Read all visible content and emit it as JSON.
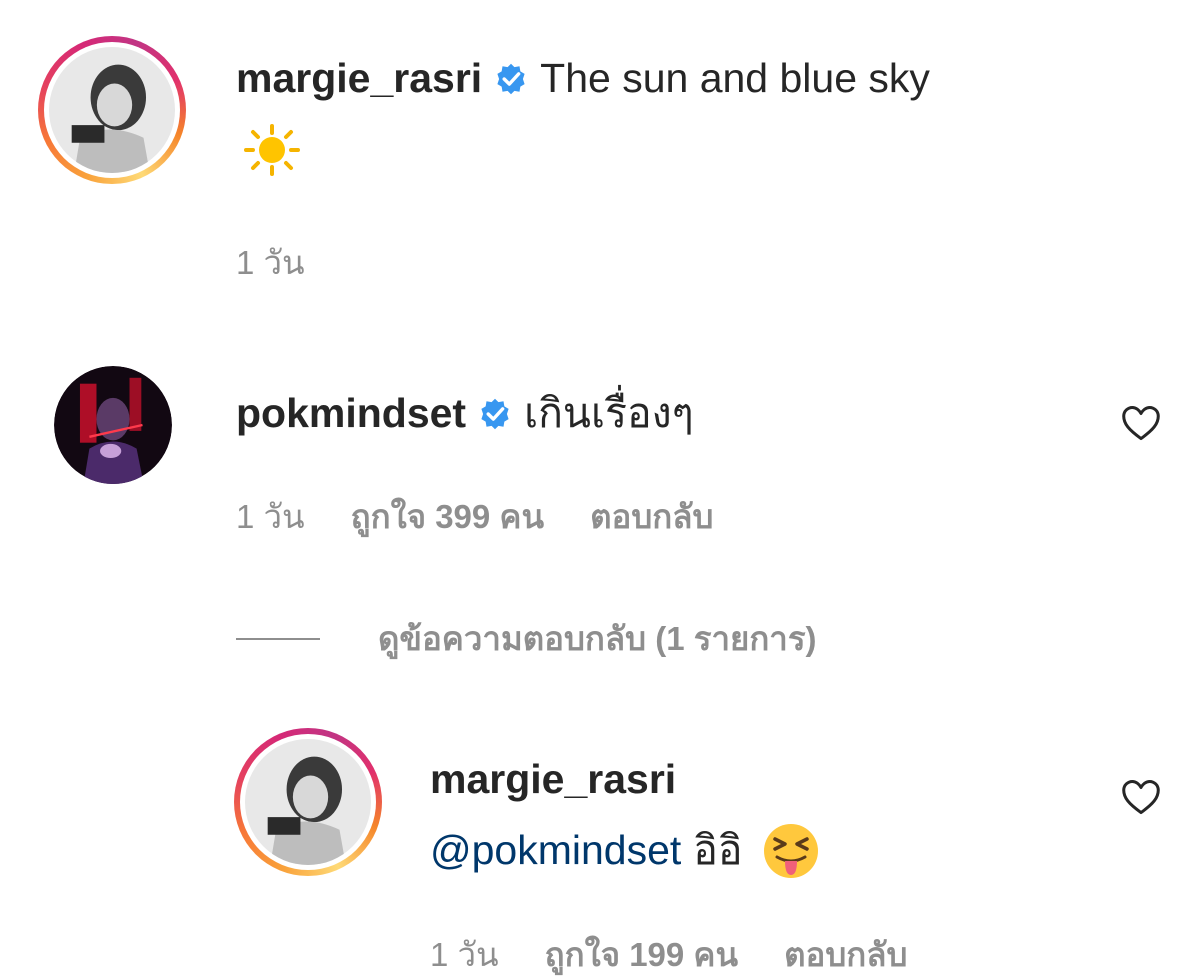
{
  "comments": [
    {
      "username": "margie_rasri",
      "verified": true,
      "text": "The sun and blue sky",
      "emoji": "sun-emoji",
      "time": "1 วัน"
    },
    {
      "username": "pokmindset",
      "verified": true,
      "text": "เกินเรื่องๆ",
      "time": "1 วัน",
      "likes": "ถูกใจ 399 คน",
      "reply": "ตอบกลับ",
      "view_replies": "ดูข้อความตอบกลับ (1 รายการ)"
    }
  ],
  "reply": {
    "username": "margie_rasri",
    "mention": "@pokmindset",
    "text": "อิอิ",
    "emoji": "squinting-tongue-emoji",
    "time": "1 วัน",
    "likes": "ถูกใจ 199 คน",
    "reply": "ตอบกลับ"
  },
  "colors": {
    "verified": "#3897f0",
    "meta": "#8e8e8e",
    "mention": "#00376b"
  }
}
